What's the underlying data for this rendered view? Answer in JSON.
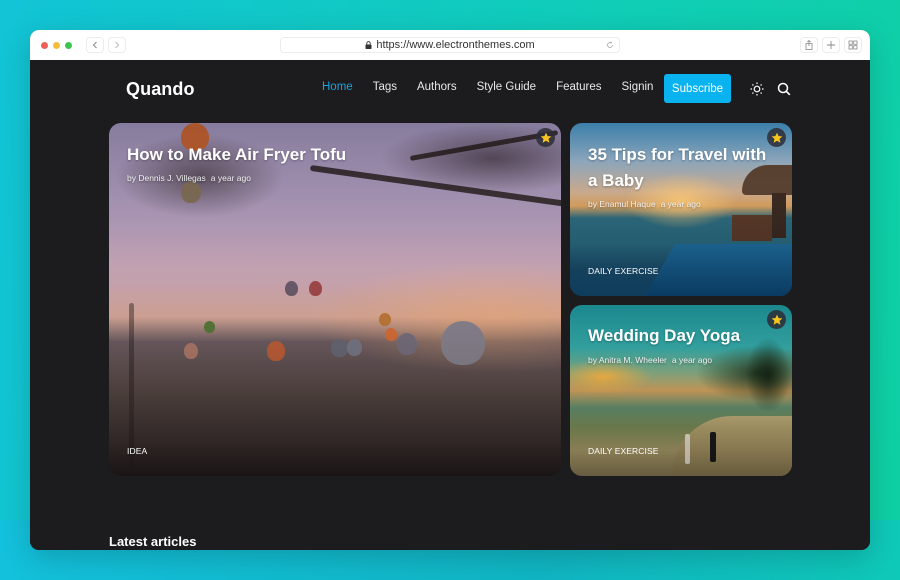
{
  "browser": {
    "url": "https://www.electronthemes.com",
    "icons": {
      "back": "chevron-left-icon",
      "forward": "chevron-right-icon",
      "lock": "lock-icon",
      "reload": "reload-icon",
      "share": "share-icon",
      "new_tab": "plus-icon",
      "tabs": "grid-icon"
    }
  },
  "header": {
    "logo": "Quando",
    "nav": [
      {
        "label": "Home",
        "active": true
      },
      {
        "label": "Tags",
        "active": false
      },
      {
        "label": "Authors",
        "active": false
      },
      {
        "label": "Style Guide",
        "active": false
      },
      {
        "label": "Features",
        "active": false
      },
      {
        "label": "Signin",
        "active": false
      }
    ],
    "subscribe_label": "Subscribe",
    "icons": {
      "theme": "sun-icon",
      "search": "search-icon"
    }
  },
  "featured": [
    {
      "title": "How to Make Air Fryer Tofu",
      "author": "by Dennis J. Villegas",
      "time": "a year ago",
      "tag": "IDEA",
      "featured_icon": "star-icon"
    },
    {
      "title": "35 Tips for Travel with a Baby",
      "author": "by Enamul Haque",
      "time": "a year ago",
      "tag": "DAILY EXERCISE",
      "featured_icon": "star-icon"
    },
    {
      "title": "Wedding Day Yoga",
      "author": "by Anitra M. Wheeler",
      "time": "a year ago",
      "tag": "DAILY EXERCISE",
      "featured_icon": "star-icon"
    }
  ],
  "sections": {
    "latest_title": "Latest articles"
  },
  "colors": {
    "accent": "#09b3f0",
    "nav_active": "#1aa3e0",
    "page_bg": "#1c1c1f",
    "star": "#f7c51e"
  }
}
